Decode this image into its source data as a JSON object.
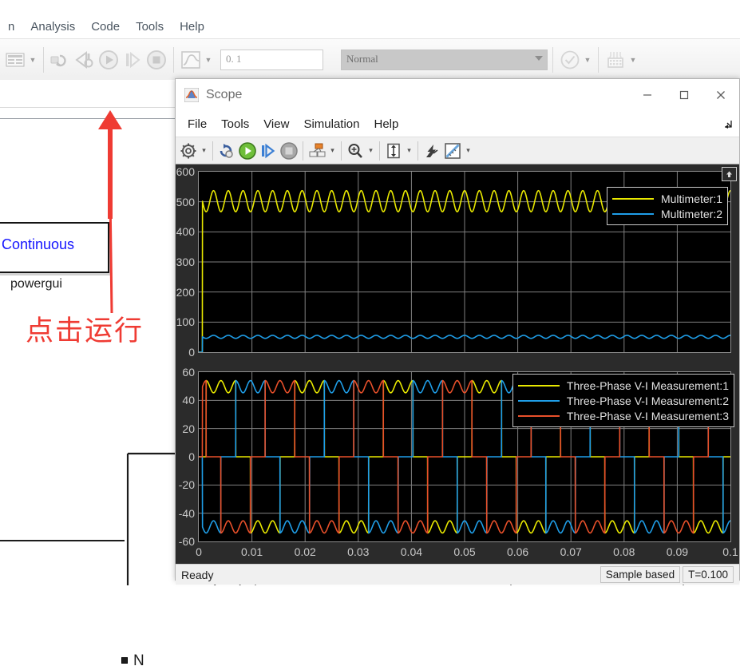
{
  "simulink": {
    "menu": [
      {
        "label": "n"
      },
      {
        "label": "Analysis"
      },
      {
        "label": "Code"
      },
      {
        "label": "Tools"
      },
      {
        "label": "Help"
      }
    ],
    "toolbar": {
      "stop_time_value": "0. 1",
      "sim_mode_value": "Normal",
      "caret_glyph": "▼",
      "buttons": [
        {
          "name": "model-explorer-button",
          "icon": "model-explorer-icon"
        },
        {
          "name": "update-model-button",
          "icon": "refresh-model-icon"
        },
        {
          "name": "step-back-button",
          "icon": "step-back-icon"
        },
        {
          "name": "run-button",
          "icon": "play-icon"
        },
        {
          "name": "step-forward-button",
          "icon": "step-forward-icon"
        },
        {
          "name": "stop-button",
          "icon": "stop-icon"
        },
        {
          "name": "data-inspector-button",
          "icon": "scope-wave-icon"
        },
        {
          "name": "check-model-button",
          "icon": "check-circle-icon"
        },
        {
          "name": "build-button",
          "icon": "build-icon"
        }
      ]
    },
    "canvas": {
      "powergui_block_label": "Continuous",
      "powergui_caption": "powergui",
      "annotation": "点击运行",
      "annotation_color": "#ef3b33",
      "terminal_label": "N"
    }
  },
  "scope": {
    "title": "Scope",
    "window_buttons": {
      "minimize": "–",
      "maximize": "☐",
      "close": "✕"
    },
    "menu": [
      {
        "label": "File"
      },
      {
        "label": "Tools"
      },
      {
        "label": "View"
      },
      {
        "label": "Simulation"
      },
      {
        "label": "Help"
      }
    ],
    "toolbar": {
      "caret_glyph": "▾",
      "buttons": [
        {
          "name": "configuration-properties-button",
          "icon": "gear-icon",
          "caret": true
        },
        {
          "name": "update-diagram-button",
          "icon": "refresh-model-icon",
          "caret": false
        },
        {
          "name": "run-button",
          "icon": "play-icon",
          "caret": false
        },
        {
          "name": "step-forward-button",
          "icon": "step-forward-icon",
          "caret": false
        },
        {
          "name": "stop-button",
          "icon": "stop-icon",
          "caret": false
        },
        {
          "name": "layout-button",
          "icon": "layout-icon",
          "caret": true
        },
        {
          "name": "zoom-button",
          "icon": "zoom-in-icon",
          "caret": true
        },
        {
          "name": "autoscale-button",
          "icon": "autoscale-icon",
          "caret": true
        },
        {
          "name": "style-button",
          "icon": "style-icon",
          "caret": false
        },
        {
          "name": "measurements-button",
          "icon": "ruler-icon",
          "caret": true
        }
      ]
    },
    "plot_pin_button": "pin-icon",
    "statusbar": {
      "status": "Ready",
      "frame_mode": "Sample based",
      "time": "T=0.100"
    }
  },
  "chart_data": [
    {
      "type": "line",
      "id": "upper-plot",
      "title": "",
      "xlabel": "",
      "ylabel": "",
      "xlim": [
        0,
        0.1
      ],
      "ylim": [
        0,
        600
      ],
      "xticks": [
        0,
        0.01,
        0.02,
        0.03,
        0.04,
        0.05,
        0.06,
        0.07,
        0.08,
        0.09,
        0.1
      ],
      "xticklabels": [
        "0",
        "0.01",
        "0.02",
        "0.03",
        "0.04",
        "0.05",
        "0.06",
        "0.07",
        "0.08",
        "0.09",
        "0.1"
      ],
      "yticks": [
        0,
        100,
        200,
        300,
        400,
        500,
        600
      ],
      "yticklabels": [
        "0",
        "100",
        "200",
        "300",
        "400",
        "500",
        "600"
      ],
      "grid": true,
      "background": "#000000",
      "legend_position": "top-right",
      "series": [
        {
          "name": "Multimeter:1",
          "color": "#e8e800",
          "description": "DC bus voltage, 6-pulse ripple between 467 and 537 V after startup ramp at t=0.0007",
          "ripple_min": 467,
          "ripple_max": 537,
          "ripple_count": 30,
          "start_value": 0
        },
        {
          "name": "Multimeter:2",
          "color": "#1f9ee8",
          "description": "DC load current, ripple around 50 A",
          "ripple_min": 46,
          "ripple_max": 56,
          "ripple_count": 30,
          "start_value": 0
        }
      ]
    },
    {
      "type": "line",
      "id": "lower-plot",
      "title": "",
      "xlabel": "",
      "ylabel": "",
      "xlim": [
        0,
        0.1
      ],
      "ylim": [
        -60,
        60
      ],
      "xticks": [
        0,
        0.01,
        0.02,
        0.03,
        0.04,
        0.05,
        0.06,
        0.07,
        0.08,
        0.09,
        0.1
      ],
      "xticklabels": [
        "0",
        "0.01",
        "0.02",
        "0.03",
        "0.04",
        "0.05",
        "0.06",
        "0.07",
        "0.08",
        "0.09",
        "0.1"
      ],
      "yticks": [
        -60,
        -40,
        -20,
        0,
        20,
        40,
        60
      ],
      "yticklabels": [
        "-60",
        "-40",
        "-20",
        "0",
        "20",
        "40",
        "60"
      ],
      "grid": true,
      "background": "#000000",
      "legend_position": "top-right",
      "series": [
        {
          "name": "Three-Phase V-I Measurement:1",
          "color": "#e8e800",
          "phase_deg": 0,
          "description": "Phase A line current, quasi-square 120-degree conduction blocks, peak 54 A",
          "peak": 54
        },
        {
          "name": "Three-Phase V-I Measurement:2",
          "color": "#1f9ee8",
          "phase_deg": -120,
          "description": "Phase B line current, quasi-square 120-degree conduction blocks, peak 54 A",
          "peak": 54
        },
        {
          "name": "Three-Phase V-I Measurement:3",
          "color": "#e8502a",
          "phase_deg": -240,
          "description": "Phase C line current, quasi-square 120-degree conduction blocks, peak 54 A",
          "peak": 54
        }
      ]
    }
  ]
}
